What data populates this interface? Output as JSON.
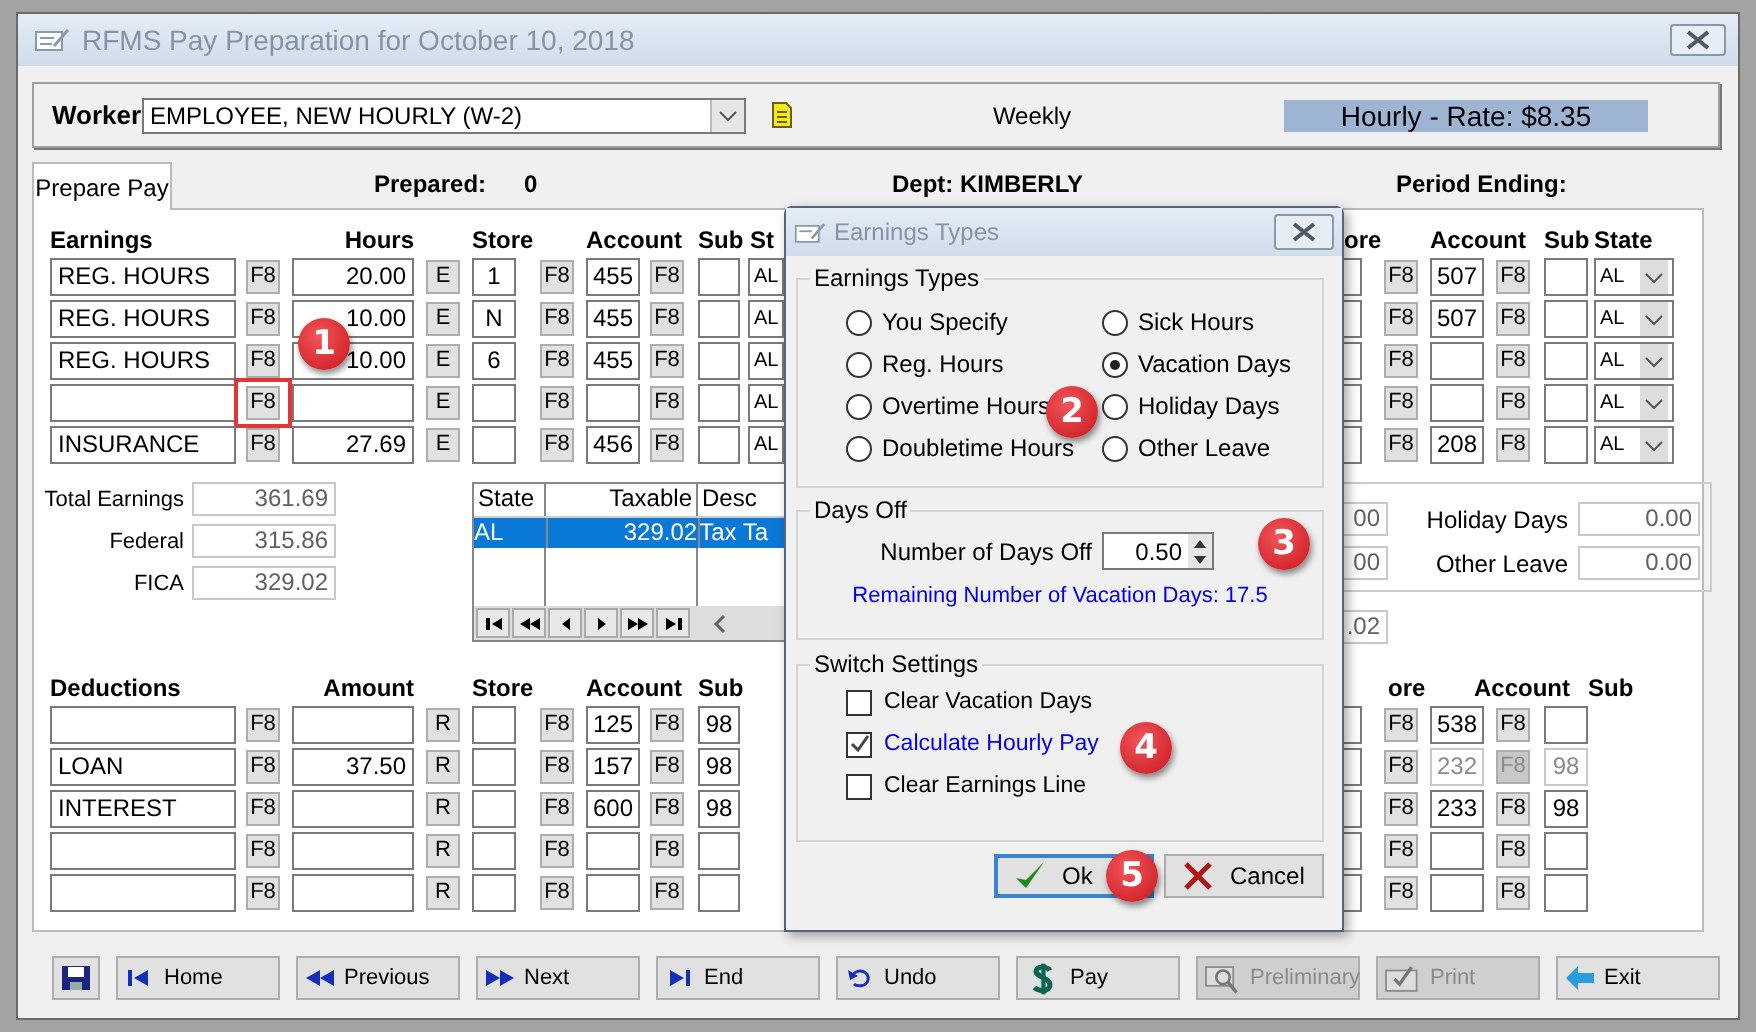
{
  "window": {
    "title": "RFMS Pay Preparation for October 10, 2018"
  },
  "worker": {
    "label": "Worker",
    "value": "EMPLOYEE, NEW HOURLY (W-2)",
    "frequency": "Weekly",
    "rate": "Hourly - Rate: $8.35"
  },
  "tabs": [
    {
      "label": "Prepare Pay",
      "selected": true
    }
  ],
  "info": {
    "prepared_label": "Prepared:",
    "prepared_value": "0",
    "dept": "Dept: KIMBERLY",
    "period_ending": "Period Ending:"
  },
  "earnings": {
    "headers_left": [
      "Earnings",
      "Hours",
      "Store",
      "Account",
      "Sub St"
    ],
    "headers_right": [
      "ore",
      "Account",
      "Sub",
      "State"
    ],
    "rows": [
      {
        "name": "REG. HOURS",
        "hours": "20.00",
        "store": "1",
        "account": "455",
        "state": "AL",
        "keys": [
          "F8",
          "E",
          "F8",
          "F8",
          "F8",
          "F8"
        ],
        "right_account": "507",
        "right_state": "AL",
        "highlighted": false
      },
      {
        "name": "REG. HOURS",
        "hours": "10.00",
        "store": "N",
        "account": "455",
        "state": "AL",
        "keys": [
          "F8",
          "E",
          "F8",
          "F8",
          "F8",
          "F8"
        ],
        "right_account": "507",
        "right_state": "AL",
        "highlighted": false
      },
      {
        "name": "REG. HOURS",
        "hours": "10.00",
        "store": "6",
        "account": "455",
        "state": "AL",
        "keys": [
          "F8",
          "E",
          "F8",
          "F8",
          "F8",
          "F8"
        ],
        "right_state": "AL",
        "highlighted": false
      },
      {
        "state": "AL",
        "keys": [
          "F8",
          "E",
          "F8",
          "F8",
          "F8",
          "F8"
        ],
        "right_state": "AL",
        "highlighted": true
      },
      {
        "name": "INSURANCE",
        "hours": "27.69",
        "account": "456",
        "state": "AL",
        "keys": [
          "F8",
          "E",
          "F8",
          "F8",
          "F8",
          "F8"
        ],
        "right_account": "208",
        "right_state": "AL",
        "highlighted": false
      }
    ]
  },
  "totals": [
    {
      "label": "Total Earnings",
      "value": "361.69"
    },
    {
      "label": "Federal",
      "value": "315.86"
    },
    {
      "label": "FICA",
      "value": "329.02"
    }
  ],
  "tax_table": {
    "columns": [
      "State",
      "Taxable",
      "Desc"
    ],
    "rows": [
      {
        "cells": [
          "AL",
          "329.02",
          "Tax Ta"
        ],
        "selected": true
      }
    ]
  },
  "leave": {
    "partial_values": [
      "00",
      "00"
    ],
    "fields": [
      {
        "label": "Holiday Days",
        "value": "0.00"
      },
      {
        "label": "Other Leave",
        "value": "0.00"
      }
    ],
    "extra": ".02"
  },
  "deductions": {
    "headers_left": [
      "Deductions",
      "Amount",
      "Store",
      "Account",
      "Sub"
    ],
    "headers_right": [
      "ore",
      "Account",
      "Sub"
    ],
    "rows": [
      {
        "account": "125",
        "sub": "98",
        "keys": [
          "F8",
          "R",
          "F8",
          "F8",
          "F8",
          "F8"
        ],
        "right_account": "538",
        "right_disabled": false
      },
      {
        "name": "LOAN",
        "amount": "37.50",
        "account": "157",
        "sub": "98",
        "keys": [
          "F8",
          "R",
          "F8",
          "F8",
          "F8",
          "F8"
        ],
        "right_account": "232",
        "right_sub": "98",
        "right_disabled": true
      },
      {
        "name": "INTEREST",
        "account": "600",
        "sub": "98",
        "keys": [
          "F8",
          "R",
          "F8",
          "F8",
          "F8",
          "F8"
        ],
        "right_account": "233",
        "right_sub": "98",
        "right_disabled": false
      },
      {
        "keys": [
          "F8",
          "R",
          "F8",
          "F8",
          "F8",
          "F8"
        ],
        "right_disabled": false
      },
      {
        "keys": [
          "F8",
          "R",
          "F8",
          "F8",
          "F8",
          "F8"
        ],
        "right_disabled": false
      }
    ]
  },
  "dialog": {
    "title": "Earnings Types",
    "types_group": "Earnings Types",
    "types": [
      {
        "label": "You Specify",
        "selected": false
      },
      {
        "label": "Sick Hours",
        "selected": false
      },
      {
        "label": "Reg. Hours",
        "selected": false
      },
      {
        "label": "Vacation Days",
        "selected": true
      },
      {
        "label": "Overtime Hours",
        "selected": false
      },
      {
        "label": "Holiday Days",
        "selected": false
      },
      {
        "label": "Doubletime Hours",
        "selected": false
      },
      {
        "label": "Other Leave",
        "selected": false
      }
    ],
    "days_group": "Days Off",
    "days_label": "Number of Days Off",
    "days_value": "0.50",
    "remaining": "Remaining Number of Vacation Days: 17.5",
    "switch_group": "Switch Settings",
    "switches": [
      {
        "label": "Clear Vacation Days",
        "checked": false,
        "emphasis": false
      },
      {
        "label": "Calculate Hourly Pay",
        "checked": true,
        "emphasis": true
      },
      {
        "label": "Clear Earnings Line",
        "checked": false,
        "emphasis": false
      }
    ],
    "buttons": [
      {
        "label": "Ok",
        "kind": "ok",
        "default": true
      },
      {
        "label": "Cancel",
        "kind": "cancel",
        "default": false
      }
    ]
  },
  "callouts": [
    "1",
    "2",
    "3",
    "4",
    "5"
  ],
  "toolbar": [
    {
      "kind": "save",
      "disabled": false
    },
    {
      "label": "Home",
      "kind": "home",
      "disabled": false
    },
    {
      "label": "Previous",
      "kind": "previous",
      "disabled": false
    },
    {
      "label": "Next",
      "kind": "next",
      "disabled": false
    },
    {
      "label": "End",
      "kind": "end",
      "disabled": false
    },
    {
      "label": "Undo",
      "kind": "undo",
      "disabled": false
    },
    {
      "label": "Pay",
      "kind": "pay",
      "disabled": false
    },
    {
      "label": "Preliminary",
      "kind": "preliminary",
      "disabled": true
    },
    {
      "label": "Print",
      "kind": "print",
      "disabled": true
    },
    {
      "label": "Exit",
      "kind": "exit",
      "disabled": false
    }
  ]
}
